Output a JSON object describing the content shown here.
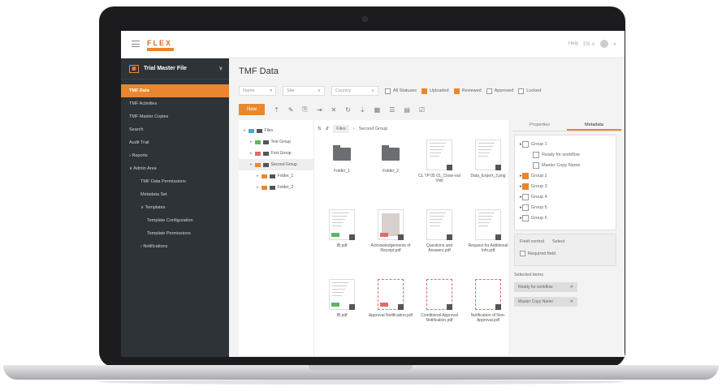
{
  "topbar": {
    "logo_text": "FLEX",
    "help": "Help",
    "lang": "EN ∨",
    "avatar_caret": "∨"
  },
  "sidebar": {
    "header": "Trial Master File",
    "items": [
      {
        "label": "TMF Data",
        "active": true,
        "level": 1
      },
      {
        "label": "TMF Activities",
        "level": 1
      },
      {
        "label": "TMF Master Copies",
        "level": 1
      },
      {
        "label": "Search",
        "level": 1
      },
      {
        "label": "Audit Trail",
        "level": 1
      },
      {
        "label": "› Reports",
        "level": 1
      },
      {
        "label": "∨ Admin Area",
        "level": 1
      },
      {
        "label": "TMF Data Permissions",
        "level": 2
      },
      {
        "label": "Metadata Set",
        "level": 2
      },
      {
        "label": "∨ Templates",
        "level": 2
      },
      {
        "label": "Template Configuration",
        "level": 3
      },
      {
        "label": "Template Permissions",
        "level": 3
      },
      {
        "label": "› Notifications",
        "level": 2
      }
    ]
  },
  "main": {
    "title": "TMF Data",
    "filters": {
      "name": "Name",
      "site": "Site",
      "country": "Country"
    },
    "checks": [
      {
        "label": "All Statuses",
        "on": false
      },
      {
        "label": "Uploaded",
        "on": true
      },
      {
        "label": "Reviewed",
        "on": true
      },
      {
        "label": "Approved",
        "on": false
      },
      {
        "label": "Locked",
        "on": false
      }
    ],
    "new_label": "New"
  },
  "tree": [
    {
      "label": "Files",
      "color": "#4aa6d6",
      "indent": 0
    },
    {
      "label": "Test Group",
      "color": "#5db85d",
      "indent": 1
    },
    {
      "label": "First Group",
      "color": "#e46a6a",
      "indent": 1
    },
    {
      "label": "Second Group",
      "color": "#e8872f",
      "indent": 1
    },
    {
      "label": "Folder_1",
      "color": "#e8872f",
      "indent": 2
    },
    {
      "label": "Folder_2",
      "color": "#e8872f",
      "indent": 2
    }
  ],
  "breadcrumb": {
    "root": "Files",
    "sep": "›",
    "current": "Second Group"
  },
  "tiles": [
    {
      "label": "Folder_1",
      "kind": "folder"
    },
    {
      "label": "Folder_2",
      "kind": "folder"
    },
    {
      "label": "CL TP 05 01_Close-out Visit",
      "kind": "doc"
    },
    {
      "label": "Data_Export_3.png",
      "kind": "doc"
    },
    {
      "label": "IB.pdf",
      "kind": "doc"
    },
    {
      "label": "Acknowledgements of Receipt.pdf",
      "kind": "photo"
    },
    {
      "label": "Questions and Answers.pdf",
      "kind": "blank"
    },
    {
      "label": "Request for Additional Info.pdf",
      "kind": "doc"
    },
    {
      "label": "IB.pdf",
      "kind": "doc"
    },
    {
      "label": "Approval Notification.pdf",
      "kind": "dash"
    },
    {
      "label": "Conditional Approval Notification.pdf",
      "kind": "dash"
    },
    {
      "label": "Notification of Non-Approval.pdf",
      "kind": "dash"
    }
  ],
  "props": {
    "tab_properties": "Properties",
    "tab_metadata": "Metadata",
    "groups": [
      {
        "label": "Group 1",
        "on": false,
        "indent": 0
      },
      {
        "label": "Ready for workflow",
        "on": false,
        "indent": 1
      },
      {
        "label": "Master Copy Name",
        "on": false,
        "indent": 1
      },
      {
        "label": "Group 2",
        "on": true,
        "indent": 0
      },
      {
        "label": "Group 3",
        "on": true,
        "indent": 0
      },
      {
        "label": "Group 4",
        "on": false,
        "indent": 0
      },
      {
        "label": "Group 5",
        "on": false,
        "indent": 0
      },
      {
        "label": "Group 6",
        "on": false,
        "indent": 0
      }
    ],
    "field_control": "Field control",
    "select": "Select",
    "required": "Required field",
    "selected_title": "Selected items",
    "selected": [
      "Ready for workflow",
      "Master Copy Name"
    ]
  }
}
